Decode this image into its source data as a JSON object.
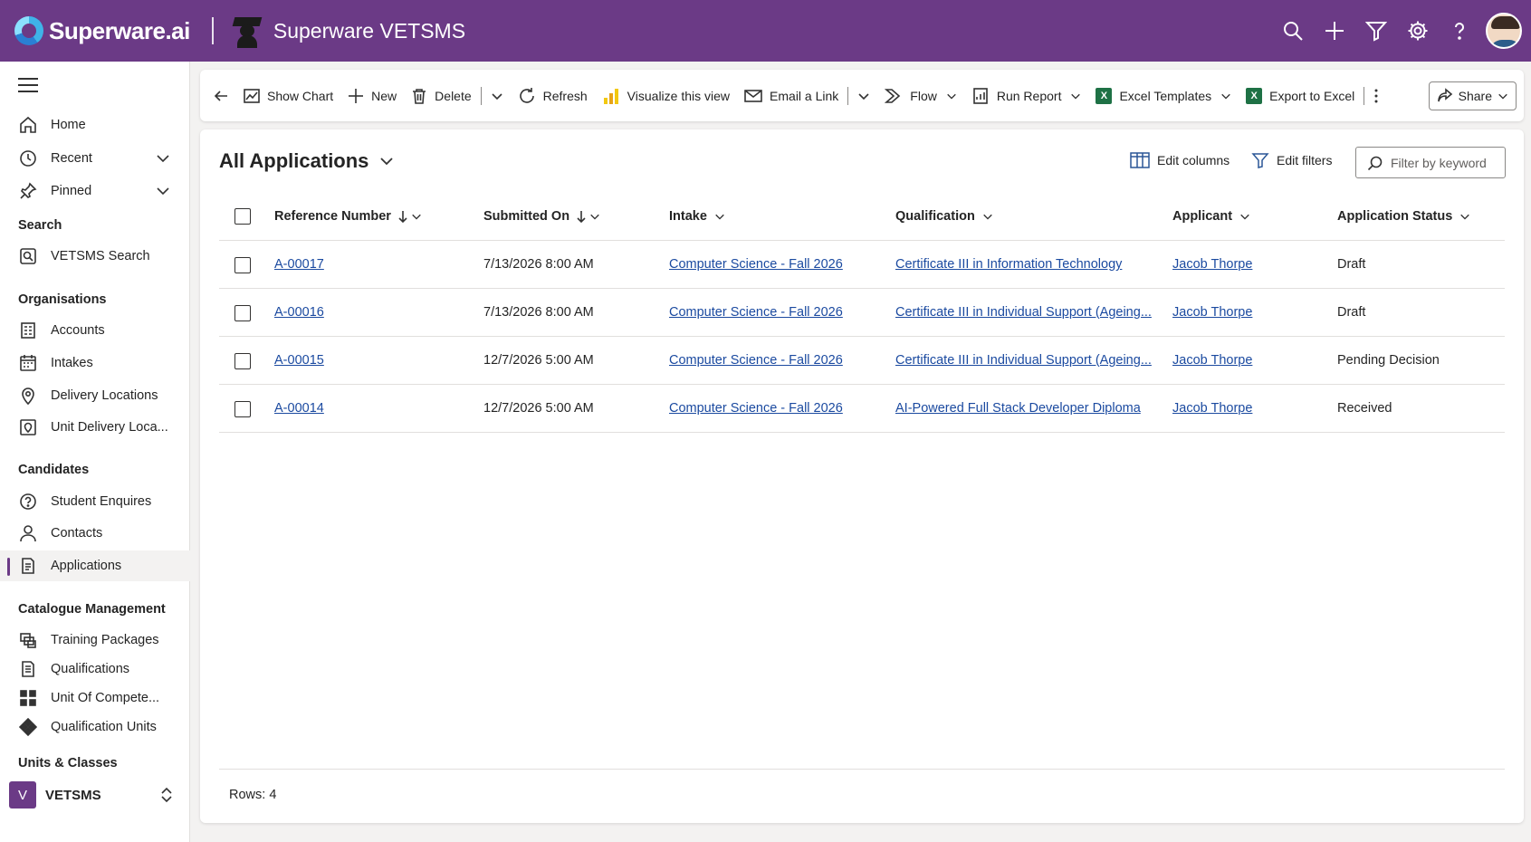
{
  "topbar": {
    "brand": "Superware.ai",
    "app_title": "Superware VETSMS"
  },
  "sidebar": {
    "items_top": [
      {
        "label": "Home",
        "icon": "home-icon"
      },
      {
        "label": "Recent",
        "icon": "clock-icon"
      },
      {
        "label": "Pinned",
        "icon": "pin-icon"
      }
    ],
    "sections": {
      "search": "Search",
      "organisations": "Organisations",
      "candidates": "Candidates",
      "catalogue": "Catalogue Management",
      "units_classes": "Units & Classes"
    },
    "search_items": [
      {
        "label": "VETSMS Search",
        "icon": "search-app-icon"
      }
    ],
    "organisation_items": [
      {
        "label": "Accounts",
        "icon": "accounts-icon"
      },
      {
        "label": "Intakes",
        "icon": "calendar-icon"
      },
      {
        "label": "Delivery Locations",
        "icon": "location-icon"
      },
      {
        "label": "Unit Delivery Loca...",
        "icon": "unit-location-icon"
      }
    ],
    "candidate_items": [
      {
        "label": "Student Enquires",
        "icon": "question-circle-icon"
      },
      {
        "label": "Contacts",
        "icon": "person-icon"
      },
      {
        "label": "Applications",
        "icon": "document-icon",
        "active": true
      }
    ],
    "catalogue_items": [
      {
        "label": "Training Packages",
        "icon": "packages-icon"
      },
      {
        "label": "Qualifications",
        "icon": "qualification-icon"
      },
      {
        "label": "Unit Of Compete...",
        "icon": "grid-icon"
      },
      {
        "label": "Qualification Units",
        "icon": "diamond-icon"
      }
    ],
    "area": {
      "badge": "V",
      "label": "VETSMS"
    }
  },
  "commandbar": {
    "show_chart": "Show Chart",
    "new": "New",
    "delete": "Delete",
    "refresh": "Refresh",
    "visualize": "Visualize this view",
    "email_link": "Email a Link",
    "flow": "Flow",
    "run_report": "Run Report",
    "excel_templates": "Excel Templates",
    "export_excel": "Export to Excel",
    "share": "Share"
  },
  "view": {
    "title": "All Applications",
    "edit_columns": "Edit columns",
    "edit_filters": "Edit filters",
    "filter_placeholder": "Filter by keyword"
  },
  "grid": {
    "columns": [
      "Reference Number",
      "Submitted On",
      "Intake",
      "Qualification",
      "Applicant",
      "Application Status"
    ],
    "rows": [
      {
        "ref": "A-00017",
        "submitted": "7/13/2026 8:00 AM",
        "intake": "Computer Science - Fall 2026",
        "qualification": "Certificate III in Information Technology",
        "applicant": "Jacob Thorpe",
        "status": "Draft"
      },
      {
        "ref": "A-00016",
        "submitted": "7/13/2026 8:00 AM",
        "intake": "Computer Science - Fall 2026",
        "qualification": "Certificate III in Individual Support (Ageing...",
        "applicant": "Jacob Thorpe",
        "status": "Draft"
      },
      {
        "ref": "A-00015",
        "submitted": "12/7/2026 5:00 AM",
        "intake": "Computer Science - Fall 2026",
        "qualification": "Certificate III in Individual Support (Ageing...",
        "applicant": "Jacob Thorpe",
        "status": "Pending Decision"
      },
      {
        "ref": "A-00014",
        "submitted": "12/7/2026 5:00 AM",
        "intake": "Computer Science - Fall 2026",
        "qualification": "AI-Powered Full Stack Developer Diploma",
        "applicant": "Jacob Thorpe",
        "status": "Received"
      }
    ],
    "rows_count": "Rows: 4"
  },
  "colors": {
    "brand": "#6b3a86",
    "link": "#1b4aa0"
  }
}
